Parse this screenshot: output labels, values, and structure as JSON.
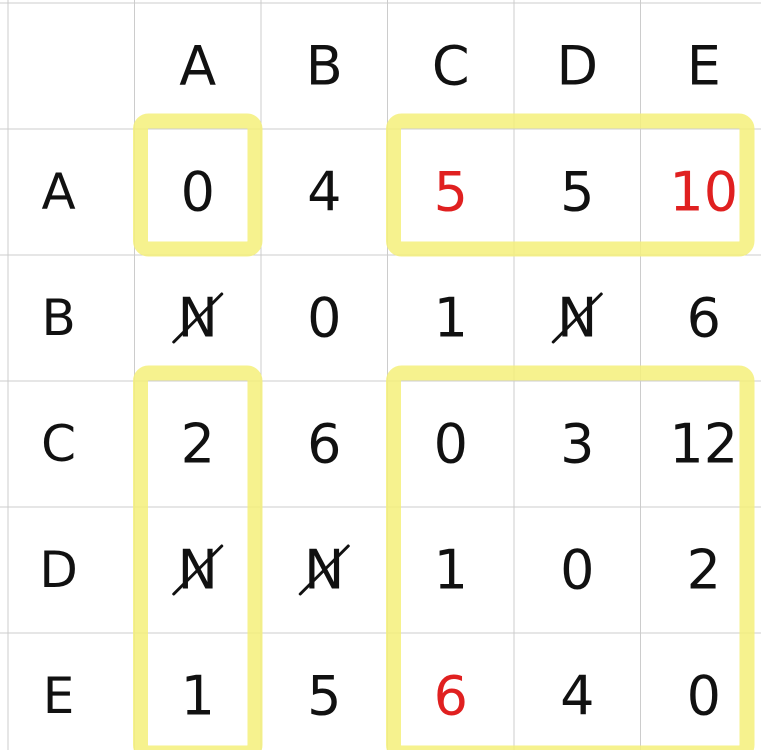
{
  "colors": {
    "background": "#ffffff",
    "grid": "#cccccc",
    "ink": "#111111",
    "highlight_red": "#e02020",
    "highlighter": "#f5f07a"
  },
  "column_headers": [
    "A",
    "B",
    "C",
    "D",
    "E"
  ],
  "row_headers": [
    "A",
    "B",
    "C",
    "D",
    "E"
  ],
  "matrix": [
    [
      {
        "v": "0"
      },
      {
        "v": "4"
      },
      {
        "v": "5",
        "red": true
      },
      {
        "v": "5"
      },
      {
        "v": "10",
        "red": true
      }
    ],
    [
      {
        "v": "N"
      },
      {
        "v": "0"
      },
      {
        "v": "1"
      },
      {
        "v": "N"
      },
      {
        "v": "6"
      }
    ],
    [
      {
        "v": "2"
      },
      {
        "v": "6"
      },
      {
        "v": "0"
      },
      {
        "v": "3"
      },
      {
        "v": "12"
      }
    ],
    [
      {
        "v": "N"
      },
      {
        "v": "N"
      },
      {
        "v": "1"
      },
      {
        "v": "0"
      },
      {
        "v": "2"
      }
    ],
    [
      {
        "v": "1"
      },
      {
        "v": "5"
      },
      {
        "v": "6",
        "red": true
      },
      {
        "v": "4"
      },
      {
        "v": "0"
      }
    ]
  ],
  "highlight_boxes": [
    {
      "name": "highlight-box-aa",
      "rows": [
        0,
        0
      ],
      "cols": [
        0,
        0
      ]
    },
    {
      "name": "highlight-box-a-cde",
      "rows": [
        0,
        0
      ],
      "cols": [
        2,
        4
      ]
    },
    {
      "name": "highlight-box-cde-a",
      "rows": [
        2,
        4
      ],
      "cols": [
        0,
        0
      ]
    },
    {
      "name": "highlight-box-cde-cde",
      "rows": [
        2,
        4
      ],
      "cols": [
        2,
        4
      ]
    }
  ]
}
